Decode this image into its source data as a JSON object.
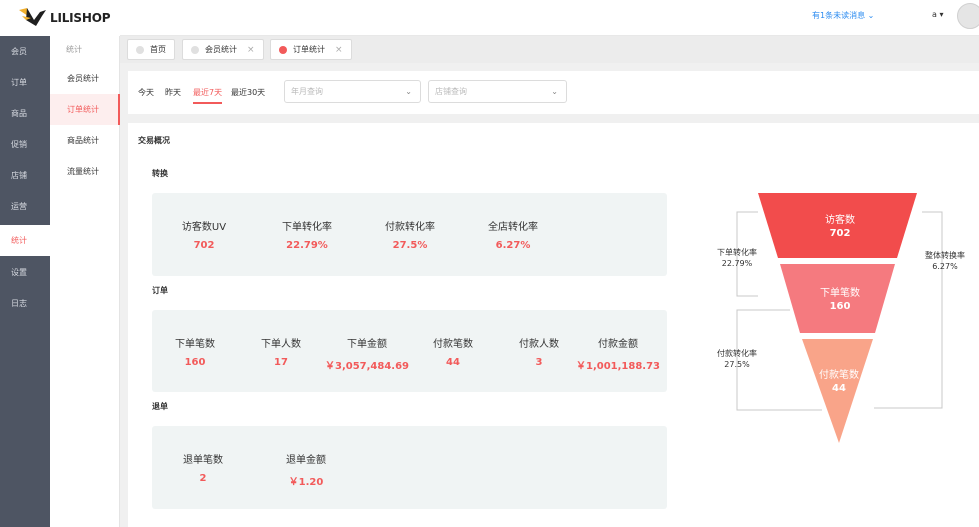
{
  "brand": {
    "logo_text": "LILISHOP"
  },
  "header": {
    "unread": "有1条未读消息",
    "user": "a"
  },
  "leftnav": {
    "items": [
      {
        "label": "会员",
        "active": false
      },
      {
        "label": "订单",
        "active": false
      },
      {
        "label": "商品",
        "active": false
      },
      {
        "label": "促销",
        "active": false
      },
      {
        "label": "店铺",
        "active": false
      },
      {
        "label": "运营",
        "active": false
      },
      {
        "label": "统计",
        "active": true
      },
      {
        "label": "设置",
        "active": false
      },
      {
        "label": "日志",
        "active": false
      }
    ]
  },
  "subnav": {
    "title": "统计",
    "items": [
      {
        "label": "会员统计"
      },
      {
        "label": "订单统计"
      },
      {
        "label": "商品统计"
      },
      {
        "label": "流量统计"
      }
    ]
  },
  "tabs": [
    {
      "label": "首页",
      "closable": false
    },
    {
      "label": "会员统计",
      "closable": true
    },
    {
      "label": "订单统计",
      "closable": true,
      "active": true
    }
  ],
  "filters": {
    "periods": [
      "今天",
      "昨天",
      "最近7天",
      "最近30天"
    ],
    "active_period": "最近7天",
    "year_month_placeholder": "年月查询",
    "shop_placeholder": "店铺查询"
  },
  "overview": {
    "title": "交易概况",
    "conversion": {
      "title": "转换",
      "metrics": [
        {
          "label": "访客数UV",
          "value": "702"
        },
        {
          "label": "下单转化率",
          "value": "22.79%"
        },
        {
          "label": "付款转化率",
          "value": "27.5%"
        },
        {
          "label": "全店转化率",
          "value": "6.27%"
        }
      ]
    },
    "orders": {
      "title": "订单",
      "metrics": [
        {
          "label": "下单笔数",
          "value": "160"
        },
        {
          "label": "下单人数",
          "value": "17"
        },
        {
          "label": "下单金额",
          "value": "￥3,057,484.69"
        },
        {
          "label": "付款笔数",
          "value": "44"
        },
        {
          "label": "付款人数",
          "value": "3"
        },
        {
          "label": "付款金额",
          "value": "￥1,001,188.73"
        }
      ]
    },
    "refunds": {
      "title": "退单",
      "metrics": [
        {
          "label": "退单笔数",
          "value": "2"
        },
        {
          "label": "退单金额",
          "value": "￥1.20"
        }
      ]
    }
  },
  "funnel": {
    "stages": [
      {
        "label": "访客数",
        "value": "702",
        "color": "#f24c4c"
      },
      {
        "label": "下单笔数",
        "value": "160",
        "color": "#f57a7f"
      },
      {
        "label": "付款笔数",
        "value": "44",
        "color": "#f9a489"
      }
    ],
    "side_labels": {
      "order_rate_label": "下单转化率",
      "order_rate": "22.79%",
      "pay_rate_label": "付款转化率",
      "pay_rate": "27.5%",
      "overall_label": "整体转换率",
      "overall": "6.27%"
    }
  }
}
